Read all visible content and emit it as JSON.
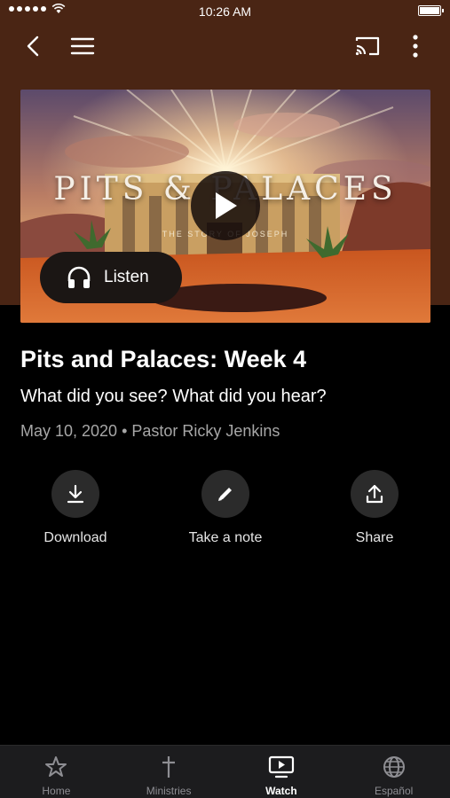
{
  "status_bar": {
    "time": "10:26 AM"
  },
  "nav": {
    "back_icon": "chevron-left-icon",
    "menu_icon": "hamburger-icon",
    "cast_icon": "cast-icon",
    "more_icon": "more-vertical-icon"
  },
  "media": {
    "artwork_title": "PITS & PALACES",
    "artwork_subtitle": "THE STORY OF JOSEPH",
    "listen_label": "Listen"
  },
  "sermon": {
    "title": "Pits and Palaces: Week 4",
    "description": "What did you see? What did you hear?",
    "meta": "May 10, 2020 • Pastor Ricky Jenkins"
  },
  "actions": [
    {
      "label": "Download",
      "icon": "download-icon"
    },
    {
      "label": "Take a note",
      "icon": "pencil-icon"
    },
    {
      "label": "Share",
      "icon": "share-icon"
    }
  ],
  "tabs": [
    {
      "label": "Home",
      "icon": "star-icon",
      "active": false
    },
    {
      "label": "Ministries",
      "icon": "cross-icon",
      "active": false
    },
    {
      "label": "Watch",
      "icon": "tv-play-icon",
      "active": true
    },
    {
      "label": "Español",
      "icon": "globe-icon",
      "active": false
    }
  ],
  "colors": {
    "header_brown": "#4a2514",
    "background": "#000000",
    "tabbar": "#1c1c1e",
    "muted_text": "#a7a7a7"
  }
}
